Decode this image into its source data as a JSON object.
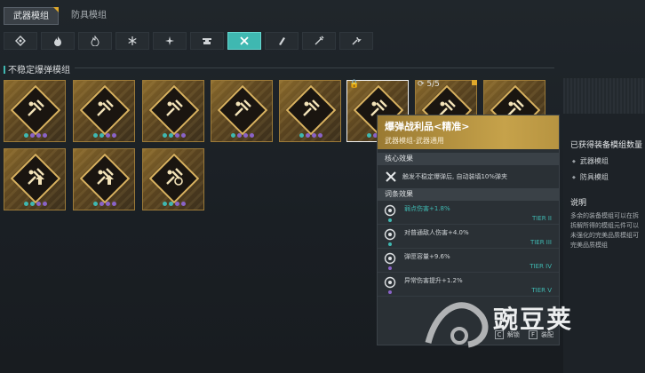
{
  "tabs": [
    {
      "label": "武器模组",
      "active": true
    },
    {
      "label": "防具模组",
      "active": false
    }
  ],
  "categories": [
    {
      "icon": "diamond-icon"
    },
    {
      "icon": "flame-icon"
    },
    {
      "icon": "flame-outline-icon"
    },
    {
      "icon": "snowflake-icon"
    },
    {
      "icon": "burst-icon"
    },
    {
      "icon": "anvil-icon"
    },
    {
      "icon": "crossed-tools-icon",
      "active": true
    },
    {
      "icon": "bullets-icon"
    },
    {
      "icon": "spark-icon"
    },
    {
      "icon": "wrench-icon"
    }
  ],
  "section_title": "不稳定爆弹模组",
  "cards": [
    {
      "icon": "explosion-icon",
      "dots": [
        "#3fb8b1",
        "#8a63c7",
        "#8a63c7",
        "#8a63c7"
      ]
    },
    {
      "icon": "explosion-icon",
      "dots": [
        "#3fb8b1",
        "#3fb8b1",
        "#8a63c7",
        "#8a63c7"
      ]
    },
    {
      "icon": "explosion-icon",
      "dots": [
        "#3fb8b1",
        "#3fb8b1",
        "#8a63c7",
        "#8a63c7"
      ]
    },
    {
      "icon": "explosion-icon",
      "dots": [
        "#3fb8b1",
        "#8a63c7",
        "#8a63c7",
        "#8a63c7"
      ]
    },
    {
      "icon": "explosion-icon",
      "dots": [
        "#3fb8b1",
        "#8a63c7",
        "#8a63c7",
        "#8a63c7"
      ]
    },
    {
      "icon": "explosion-icon",
      "dots": [
        "#3fb8b1",
        "#8a63c7",
        "#8a63c7",
        "#8a63c7"
      ],
      "selected": true
    },
    {
      "icon": "explosion-icon",
      "dots": [
        "#3fb8b1",
        "#8a63c7",
        "#8a63c7",
        "#8a63c7"
      ]
    },
    {
      "icon": "explosion-icon",
      "dots": [
        "#3fb8b1",
        "#8a63c7",
        "#8a63c7",
        "#8a63c7"
      ]
    },
    {
      "icon": "explosion-arrow-icon",
      "dots": [
        "#3fb8b1",
        "#3fb8b1",
        "#8a63c7",
        "#8a63c7"
      ]
    },
    {
      "icon": "explosion-arrow-icon",
      "dots": [
        "#3fb8b1",
        "#8a63c7",
        "#8a63c7",
        "#8a63c7"
      ]
    },
    {
      "icon": "explosion-spiral-icon",
      "dots": [
        "#3fb8b1",
        "#3fb8b1",
        "#8a63c7",
        "#8a63c7"
      ]
    }
  ],
  "selected_badge": "5/5",
  "tooltip": {
    "title": "爆弹战利品<精准>",
    "subtitle": "武器模组-武器通用",
    "core_heading": "核心效果",
    "core_text": "触发不稳定爆弹后, 自动装填10%弹夹",
    "affix_heading": "词条效果",
    "affixes": [
      {
        "text": "弱点伤害+1.8%",
        "tier": "TIER II",
        "color": "#3fb8b1",
        "highlight": true
      },
      {
        "text": "对普通敌人伤害+4.0%",
        "tier": "TIER III",
        "color": "#3fb8b1"
      },
      {
        "text": "弹匣容量+9.6%",
        "tier": "TIER IV",
        "color": "#8a63c7"
      },
      {
        "text": "异常伤害提升+1.2%",
        "tier": "TIER V",
        "color": "#8a63c7"
      }
    ],
    "footer": [
      {
        "key": "C",
        "label": "解锁"
      },
      {
        "key": "F",
        "label": "装配"
      }
    ]
  },
  "right_panel": {
    "title": "已获得装备模组数量",
    "items": [
      "武器模组",
      "防具模组"
    ],
    "desc_heading": "说明",
    "desc_lines": [
      "多余的装备模组可以在拆",
      "拆解所得的模组元件可以",
      "未强化的完美品质模组可",
      "完美品质模组"
    ]
  },
  "watermark": "豌豆荚"
}
